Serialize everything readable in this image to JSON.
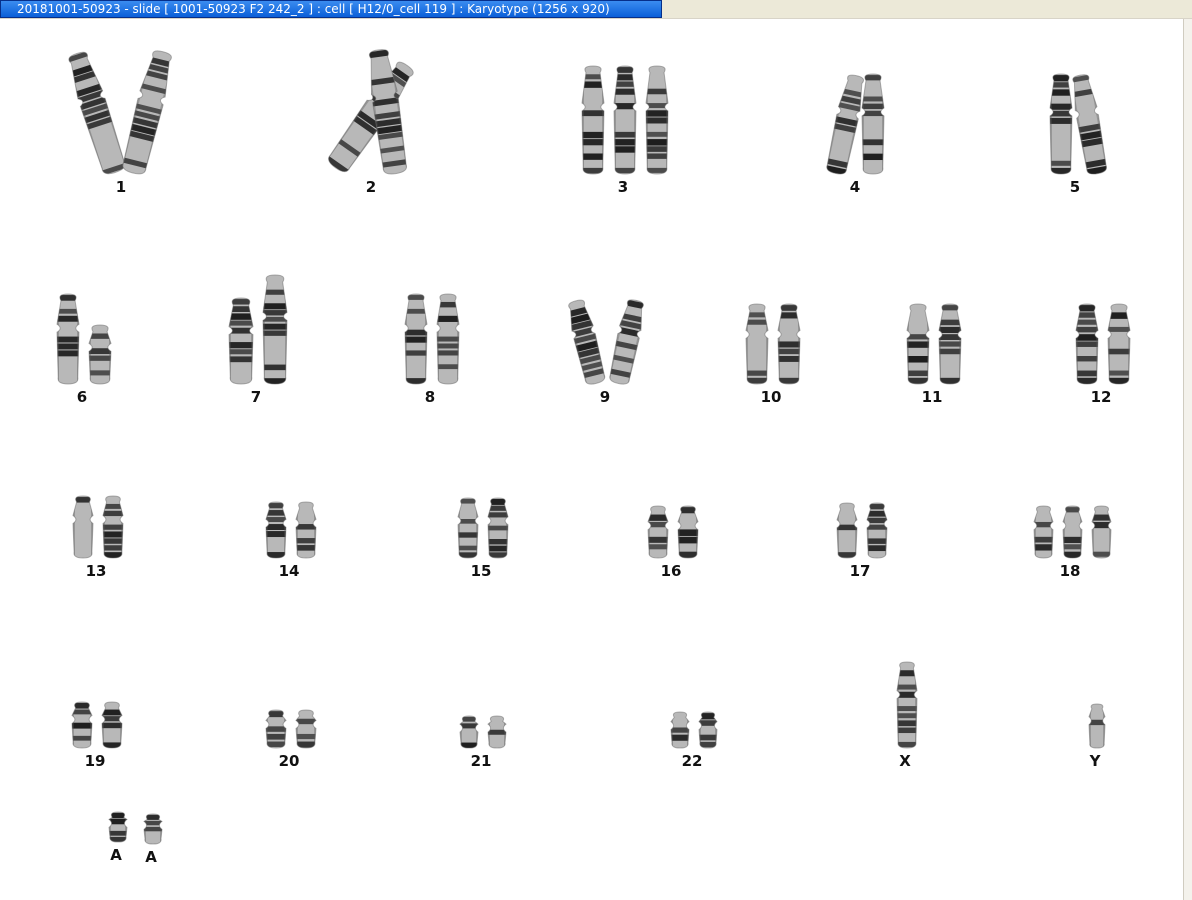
{
  "window": {
    "title": "20181001-50923 - slide [ 1001-50923 F2 242_2 ] : cell [ H12/0_cell 119 ] : Karyotype  (1256 x 920)"
  },
  "karyotype": {
    "groups": [
      {
        "label": "1",
        "count": 2
      },
      {
        "label": "2",
        "count": 2
      },
      {
        "label": "3",
        "count": 3
      },
      {
        "label": "4",
        "count": 2
      },
      {
        "label": "5",
        "count": 2
      },
      {
        "label": "6",
        "count": 2
      },
      {
        "label": "7",
        "count": 2
      },
      {
        "label": "8",
        "count": 2
      },
      {
        "label": "9",
        "count": 2
      },
      {
        "label": "10",
        "count": 2
      },
      {
        "label": "11",
        "count": 2
      },
      {
        "label": "12",
        "count": 2
      },
      {
        "label": "13",
        "count": 2
      },
      {
        "label": "14",
        "count": 2
      },
      {
        "label": "15",
        "count": 2
      },
      {
        "label": "16",
        "count": 2
      },
      {
        "label": "17",
        "count": 2
      },
      {
        "label": "18",
        "count": 3
      },
      {
        "label": "19",
        "count": 2
      },
      {
        "label": "20",
        "count": 2
      },
      {
        "label": "21",
        "count": 2
      },
      {
        "label": "22",
        "count": 2
      },
      {
        "label": "X",
        "count": 1
      },
      {
        "label": "Y",
        "count": 1
      },
      {
        "label": "A",
        "count": 1
      },
      {
        "label": "A",
        "count": 1
      }
    ]
  },
  "colors": {
    "titlebar": "#0a5fd8",
    "chromosome_dark": "#2a2a2a",
    "chromosome_light": "#b8b8b8"
  }
}
